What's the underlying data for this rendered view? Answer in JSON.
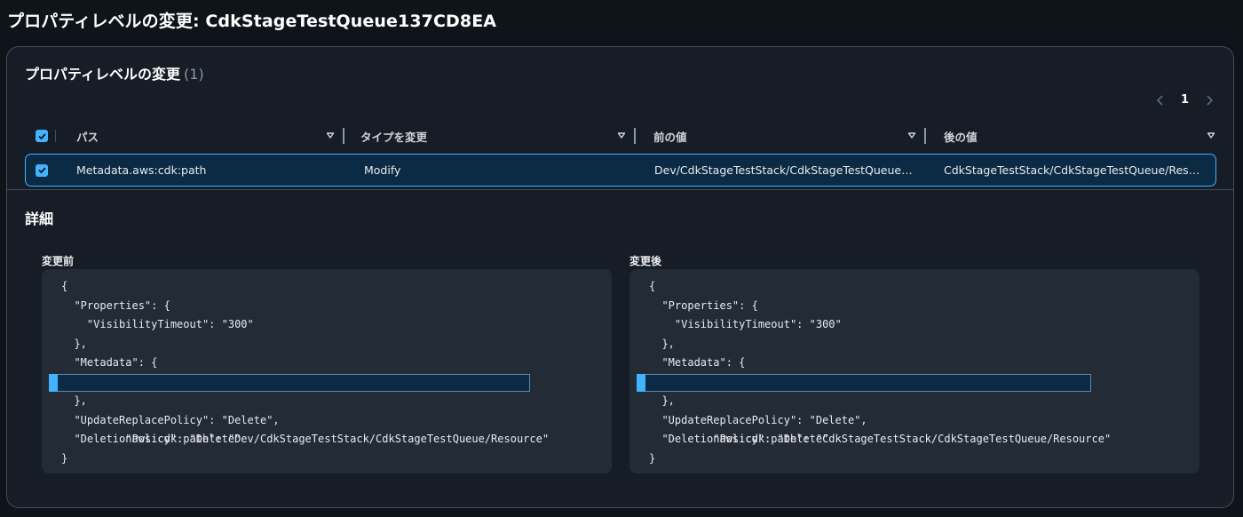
{
  "page": {
    "title": "プロパティレベルの変更: CdkStageTestQueue137CD8EA"
  },
  "panel": {
    "header": "プロパティレベルの変更",
    "count": "(1)",
    "pagination": {
      "current_page": "1"
    }
  },
  "table": {
    "columns": [
      {
        "label": "パス"
      },
      {
        "label": "タイプを変更"
      },
      {
        "label": "前の値"
      },
      {
        "label": "後の値"
      }
    ],
    "rows": [
      {
        "selected": true,
        "path": "Metadata.aws:cdk:path",
        "change_type": "Modify",
        "before": "Dev/CdkStageTestStack/CdkStageTestQueue…",
        "after": "CdkStageTestStack/CdkStageTestQueue/Res…"
      }
    ]
  },
  "details": {
    "title": "詳細",
    "before": {
      "label": "変更前",
      "lines": [
        "{",
        "  \"Properties\": {",
        "    \"VisibilityTimeout\": \"300\"",
        "  },",
        "  \"Metadata\": {",
        "    \"aws:cdk:path\": \"Dev/CdkStageTestStack/CdkStageTestQueue/Resource\"",
        "  },",
        "  \"UpdateReplacePolicy\": \"Delete\",",
        "  \"DeletionPolicy\": \"Delete\"",
        "}"
      ]
    },
    "after": {
      "label": "変更後",
      "lines": [
        "{",
        "  \"Properties\": {",
        "    \"VisibilityTimeout\": \"300\"",
        "  },",
        "  \"Metadata\": {",
        "    \"aws:cdk:path\": \"CdkStageTestStack/CdkStageTestQueue/Resource\"",
        "  },",
        "  \"UpdateReplacePolicy\": \"Delete\",",
        "  \"DeletionPolicy\": \"Delete\"",
        "}"
      ]
    }
  },
  "icons": {
    "sort": "caret-down-icon",
    "prev": "chevron-left-icon",
    "next": "chevron-right-icon",
    "check": "check-icon"
  },
  "colors": {
    "accent": "#42b4ff",
    "background": "#0f141a",
    "panel": "#161d26",
    "selected_row": "#0b2a44"
  }
}
